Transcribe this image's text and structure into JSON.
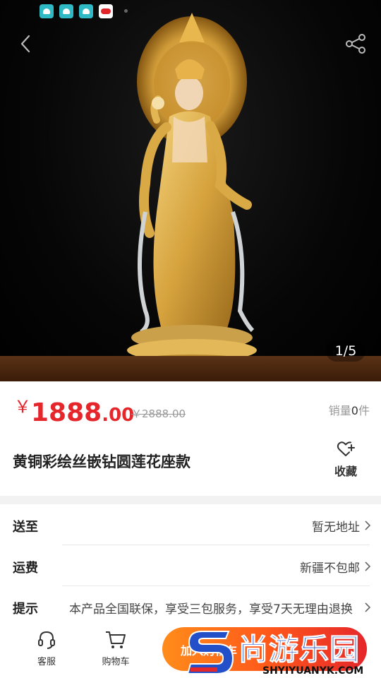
{
  "status_bar": {
    "icons": [
      "app-icon",
      "app-icon",
      "app-icon",
      "weibo-icon"
    ]
  },
  "gallery": {
    "pager": "1/5"
  },
  "product": {
    "currency": "￥",
    "price_int": "1888",
    "price_dec": ".00",
    "original_price": "￥2888.00",
    "sales_label": "销量",
    "sales_count": "0",
    "sales_unit": "件",
    "title": "黄铜彩绘丝嵌钻圆莲花座款",
    "favorite_label": "收藏"
  },
  "info": {
    "rows": [
      {
        "label": "送至",
        "value": "暂无地址"
      },
      {
        "label": "运费",
        "value": "新疆不包邮"
      },
      {
        "label": "提示",
        "value": "本产品全国联保，享受三包服务，享受7天无理由退换"
      }
    ]
  },
  "bottom_bar": {
    "service_label": "客服",
    "cart_label": "购物车",
    "cta_label": "加入购物车"
  },
  "watermark": {
    "title": "尚游乐园",
    "url": "SHYIYUANYK.COM",
    "color": "#2350c8"
  },
  "colors": {
    "price": "#e5262b",
    "cta_start": "#ff8c1a",
    "cta_end": "#e5262b"
  }
}
